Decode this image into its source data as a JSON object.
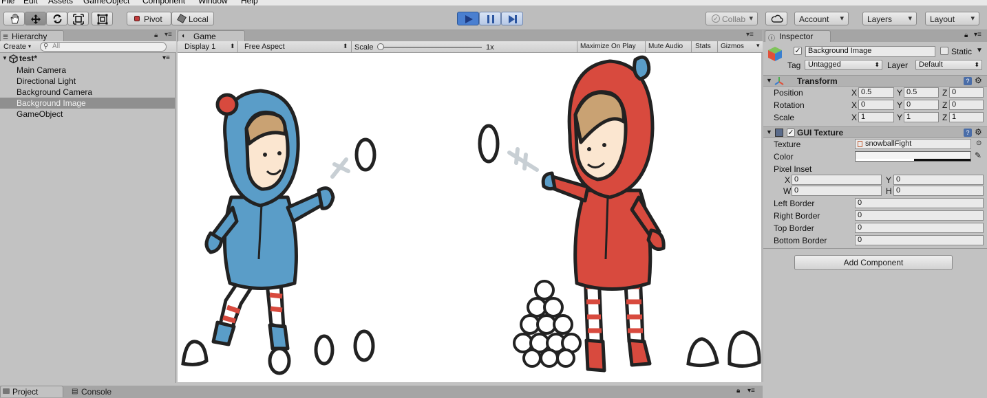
{
  "menu": [
    "File",
    "Edit",
    "Assets",
    "GameObject",
    "Component",
    "Window",
    "Help"
  ],
  "toolbar": {
    "pivot_label": "Pivot",
    "local_label": "Local",
    "collab_label": "Collab",
    "account_label": "Account",
    "layers_label": "Layers",
    "layout_label": "Layout"
  },
  "hierarchy": {
    "tab_label": "Hierarchy",
    "create_label": "Create",
    "search_placeholder": "All",
    "scene_name": "test*",
    "items": [
      "Main Camera",
      "Directional Light",
      "Background Camera",
      "Background Image",
      "GameObject"
    ],
    "selected_index": 3
  },
  "game": {
    "tab_label": "Game",
    "display_label": "Display 1",
    "aspect_label": "Free Aspect",
    "scale_label": "Scale",
    "scale_value": "1x",
    "maximize_label": "Maximize On Play",
    "mute_label": "Mute Audio",
    "stats_label": "Stats",
    "gizmos_label": "Gizmos"
  },
  "inspector": {
    "tab_label": "Inspector",
    "object_name": "Background Image",
    "static_label": "Static",
    "tag_label": "Tag",
    "tag_value": "Untagged",
    "layer_label": "Layer",
    "layer_value": "Default",
    "transform": {
      "title": "Transform",
      "position_label": "Position",
      "rotation_label": "Rotation",
      "scale_label": "Scale",
      "position": {
        "x": "0.5",
        "y": "0.5",
        "z": "0"
      },
      "rotation": {
        "x": "0",
        "y": "0",
        "z": "0"
      },
      "scale": {
        "x": "1",
        "y": "1",
        "z": "1"
      }
    },
    "gui_texture": {
      "title": "GUI Texture",
      "texture_label": "Texture",
      "texture_value": "snowballFight",
      "color_label": "Color",
      "pixel_inset_label": "Pixel Inset",
      "inset": {
        "x": "0",
        "y": "0",
        "w": "0",
        "h": "0"
      },
      "left_border_label": "Left Border",
      "left_border": "0",
      "right_border_label": "Right Border",
      "right_border": "0",
      "top_border_label": "Top Border",
      "top_border": "0",
      "bottom_border_label": "Bottom Border",
      "bottom_border": "0"
    },
    "add_component_label": "Add Component"
  },
  "bottom": {
    "project_label": "Project",
    "console_label": "Console"
  },
  "axis_letters": {
    "x": "X",
    "y": "Y",
    "z": "Z",
    "w": "W",
    "h": "H"
  },
  "colors": {
    "play_active": "#4a7fd0",
    "blue_coat": "#5a9dc8",
    "red_coat": "#d84a3e"
  }
}
